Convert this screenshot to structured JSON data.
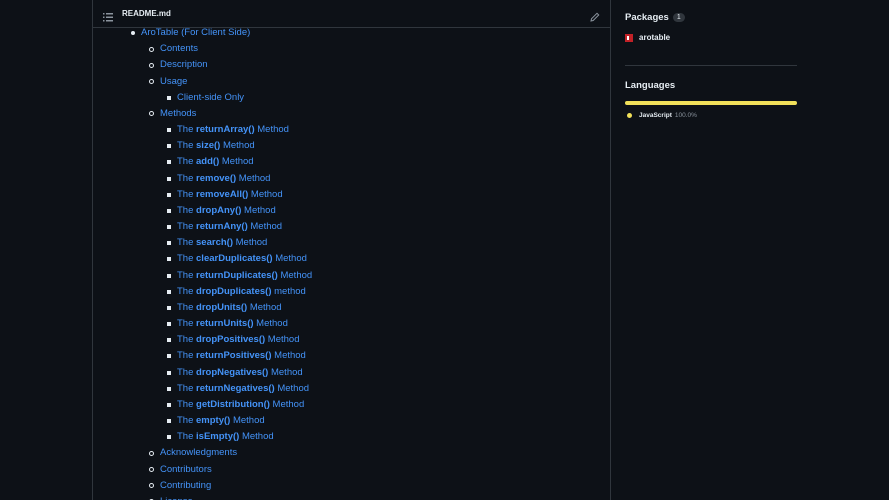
{
  "readme": {
    "title": "README.md",
    "toc": [
      {
        "level": 0,
        "text": "AroTable (For Client Side)"
      },
      {
        "level": 1,
        "text": "Contents"
      },
      {
        "level": 1,
        "text": "Description"
      },
      {
        "level": 1,
        "text": "Usage"
      },
      {
        "level": 2,
        "text": "Client-side Only"
      },
      {
        "level": 1,
        "text": "Methods"
      },
      {
        "level": 2,
        "pre": "The ",
        "bold": "returnArray()",
        "post": " Method"
      },
      {
        "level": 2,
        "pre": "The ",
        "bold": "size()",
        "post": " Method"
      },
      {
        "level": 2,
        "pre": "The ",
        "bold": "add()",
        "post": " Method"
      },
      {
        "level": 2,
        "pre": "The ",
        "bold": "remove()",
        "post": " Method"
      },
      {
        "level": 2,
        "pre": "The ",
        "bold": "removeAll()",
        "post": " Method"
      },
      {
        "level": 2,
        "pre": "The ",
        "bold": "dropAny()",
        "post": " Method"
      },
      {
        "level": 2,
        "pre": "The ",
        "bold": "returnAny()",
        "post": " Method"
      },
      {
        "level": 2,
        "pre": "The ",
        "bold": "search()",
        "post": " Method"
      },
      {
        "level": 2,
        "pre": "The ",
        "bold": "clearDuplicates()",
        "post": " Method"
      },
      {
        "level": 2,
        "pre": "The ",
        "bold": "returnDuplicates()",
        "post": " Method"
      },
      {
        "level": 2,
        "pre": "The ",
        "bold": "dropDuplicates()",
        "post": " method"
      },
      {
        "level": 2,
        "pre": "The ",
        "bold": "dropUnits()",
        "post": " Method"
      },
      {
        "level": 2,
        "pre": "The ",
        "bold": "returnUnits()",
        "post": " Method"
      },
      {
        "level": 2,
        "pre": "The ",
        "bold": "dropPositives()",
        "post": " Method"
      },
      {
        "level": 2,
        "pre": "The ",
        "bold": "returnPositives()",
        "post": " Method"
      },
      {
        "level": 2,
        "pre": "The ",
        "bold": "dropNegatives()",
        "post": " Method"
      },
      {
        "level": 2,
        "pre": "The ",
        "bold": "returnNegatives()",
        "post": " Method"
      },
      {
        "level": 2,
        "pre": "The ",
        "bold": "getDistribution()",
        "post": " Method"
      },
      {
        "level": 2,
        "pre": "The ",
        "bold": "empty()",
        "post": " Method"
      },
      {
        "level": 2,
        "pre": "The ",
        "bold": "isEmpty()",
        "post": " Method"
      },
      {
        "level": 1,
        "text": "Acknowledgments"
      },
      {
        "level": 1,
        "text": "Contributors"
      },
      {
        "level": 1,
        "text": "Contributing"
      },
      {
        "level": 1,
        "text": "License"
      }
    ]
  },
  "sidebar": {
    "packages": {
      "title": "Packages",
      "count": "1",
      "items": [
        {
          "name": "arotable",
          "icon": "npm-icon"
        }
      ]
    },
    "languages": {
      "title": "Languages",
      "items": [
        {
          "name": "JavaScript",
          "percent": "100.0%",
          "color": "#f1e05a"
        }
      ]
    }
  },
  "colors": {
    "background": "#0d1117",
    "link": "#4493f8",
    "border": "#30363d",
    "text": "#e6edf3",
    "muted": "#8b949e"
  }
}
